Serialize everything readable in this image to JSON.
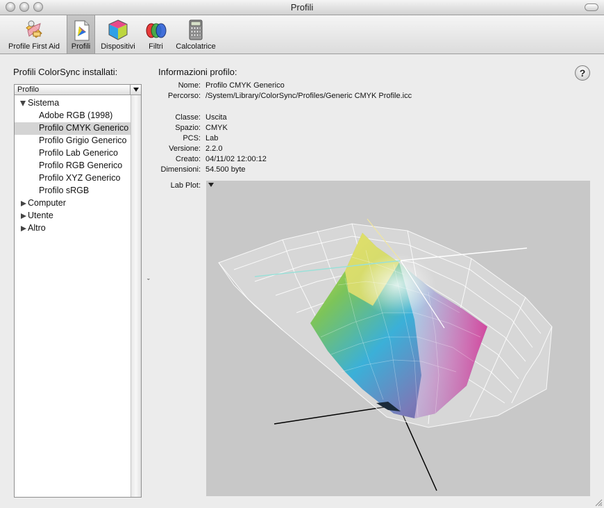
{
  "window": {
    "title": "Profili"
  },
  "toolbar": {
    "items": [
      {
        "label": "Profile First Aid",
        "icon": "first-aid-icon"
      },
      {
        "label": "Profili",
        "icon": "profiles-icon",
        "selected": true
      },
      {
        "label": "Dispositivi",
        "icon": "devices-cube-icon"
      },
      {
        "label": "Filtri",
        "icon": "filters-icon"
      },
      {
        "label": "Calcolatrice",
        "icon": "calculator-icon"
      }
    ]
  },
  "sidebar": {
    "heading": "Profili ColorSync installati:",
    "column_header": "Profilo",
    "groups": [
      {
        "label": "Sistema",
        "expanded": true,
        "items": [
          "Adobe RGB (1998)",
          "Profilo CMYK Generico",
          "Profilo Grigio Generico",
          "Profilo Lab Generico",
          "Profilo RGB Generico",
          "Profilo XYZ Generico",
          "Profilo sRGB"
        ],
        "selected_item": "Profilo CMYK Generico"
      },
      {
        "label": "Computer",
        "expanded": false
      },
      {
        "label": "Utente",
        "expanded": false
      },
      {
        "label": "Altro",
        "expanded": false
      }
    ]
  },
  "info": {
    "heading": "Informazioni profilo:",
    "help_label": "?",
    "fields": {
      "nome_key": "Nome:",
      "nome": "Profilo CMYK Generico",
      "percorso_key": "Percorso:",
      "percorso": "/System/Library/ColorSync/Profiles/Generic CMYK Profile.icc",
      "classe_key": "Classe:",
      "classe": "Uscita",
      "spazio_key": "Spazio:",
      "spazio": "CMYK",
      "pcs_key": "PCS:",
      "pcs": "Lab",
      "versione_key": "Versione:",
      "versione": "2.2.0",
      "creato_key": "Creato:",
      "creato": "04/11/02 12:00:12",
      "dimensioni_key": "Dimensioni:",
      "dimensioni": "54.500 byte"
    },
    "plot_label": "Lab Plot:"
  },
  "colors": {
    "window_bg": "#ececec",
    "plot_bg": "#c8c8c8",
    "selection": "#d4d4d4"
  }
}
